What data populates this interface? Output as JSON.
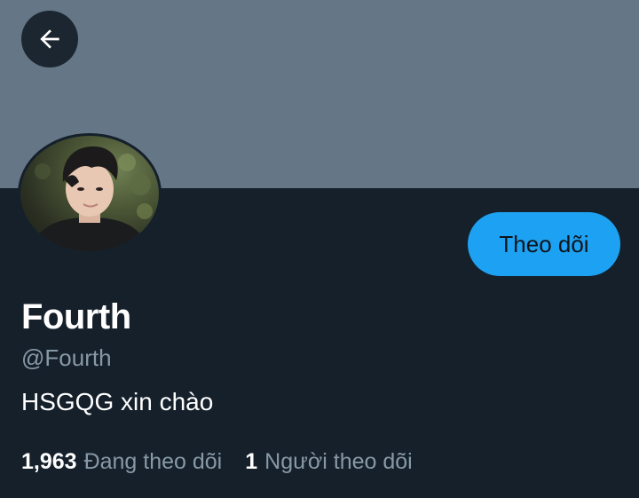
{
  "profile": {
    "display_name": "Fourth",
    "handle": "@Fourth",
    "bio": "HSGQG xin chào",
    "follow_button_label": "Theo dõi"
  },
  "stats": {
    "following_count": "1,963",
    "following_label": "Đang theo dõi",
    "followers_count": "1",
    "followers_label": "Người theo dõi"
  },
  "icons": {
    "back": "arrow-left-icon",
    "avatar": "profile-photo"
  },
  "colors": {
    "banner": "#657786",
    "background": "#15202b",
    "accent": "#1da1f2",
    "secondary_text": "#8899a6"
  }
}
